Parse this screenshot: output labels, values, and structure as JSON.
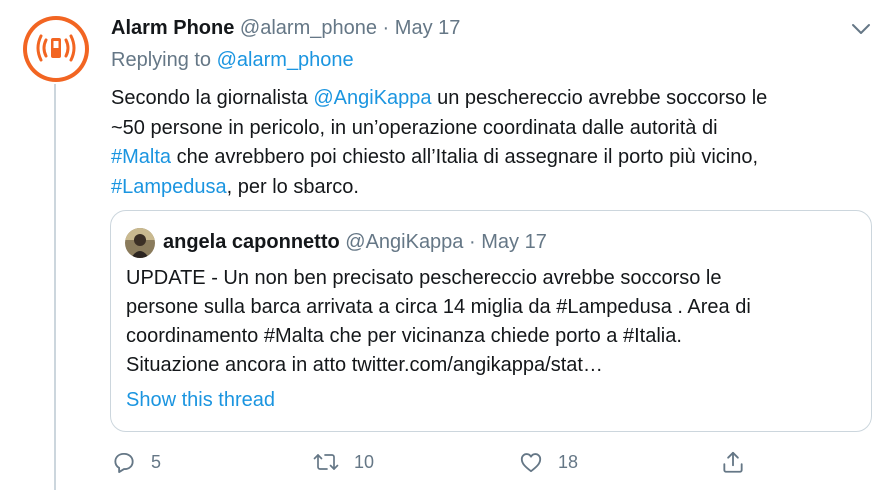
{
  "tweet": {
    "author_name": "Alarm Phone",
    "author_handle": "@alarm_phone",
    "separator": "·",
    "date": "May 17",
    "replying_prefix": "Replying to",
    "replying_handle": "@alarm_phone",
    "text": {
      "l1_pre": "Secondo la giornalista ",
      "l1_mention": "@AngiKappa",
      "l1_post": " un peschereccio avrebbe soccorso le",
      "l2": "~50 persone in pericolo, in un’operazione coordinata dalle autorità di",
      "l3_hashtag": "#Malta",
      "l3_post": " che avrebbero poi chiesto all’Italia di assegnare il porto più vicino,",
      "l4_hashtag": "#Lampedusa",
      "l4_post": ", per lo sbarco."
    }
  },
  "quoted": {
    "author_name": "angela caponnetto",
    "author_handle": "@AngiKappa",
    "separator": "·",
    "date": "May 17",
    "lines": [
      "UPDATE - Un non ben precisato peschereccio avrebbe soccorso le",
      "persone sulla barca arrivata a circa 14 miglia da #Lampedusa . Area di",
      "coordinamento #Malta che per vicinanza chiede porto a #Italia.",
      "Situazione ancora in atto twitter.com/angikappa/stat…"
    ],
    "show_thread": "Show this thread"
  },
  "actions": {
    "reply_count": "5",
    "retweet_count": "10",
    "like_count": "18"
  },
  "colors": {
    "link": "#1b95e0",
    "muted": "#657786",
    "brand": "#f26522"
  },
  "icons": [
    "alarm-phone-logo",
    "chevron-down-icon",
    "reply-icon",
    "retweet-icon",
    "like-icon",
    "share-icon"
  ]
}
